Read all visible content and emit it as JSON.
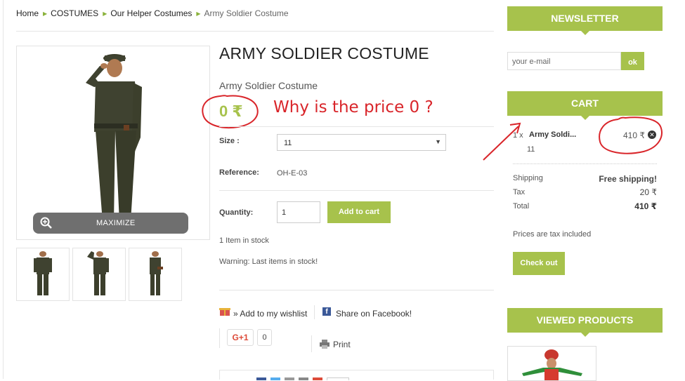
{
  "breadcrumb": {
    "items": [
      "Home",
      "COSTUMES",
      "Our Helper Costumes"
    ],
    "current": "Army Soldier Costume"
  },
  "product": {
    "title": "ARMY SOLDIER COSTUME",
    "subtitle": "Army Soldier Costume",
    "price": "0 ₹",
    "size_label": "Size :",
    "size_value": "11",
    "reference_label": "Reference:",
    "reference_value": "OH-E-03",
    "quantity_label": "Quantity:",
    "quantity_value": "1",
    "add_to_cart": "Add to cart",
    "stock": "1 Item in stock",
    "warning": "Warning: Last items in stock!",
    "maximize": "MAXIMIZE",
    "wishlist": "» Add to my wishlist",
    "facebook": "Share on Facebook!",
    "gplus": "G+1",
    "gplus_count": "0",
    "print": "Print"
  },
  "annotation": {
    "text": "Why is the price 0 ?",
    "color": "#d9252a"
  },
  "newsletter": {
    "title": "NEWSLETTER",
    "placeholder": "your e-mail",
    "ok": "ok"
  },
  "cart": {
    "title": "CART",
    "item": {
      "qty": "1 x",
      "name": "Army Soldi...",
      "price": "410 ₹",
      "attr": "11"
    },
    "shipping_label": "Shipping",
    "shipping_value": "Free shipping!",
    "tax_label": "Tax",
    "tax_value": "20 ₹",
    "total_label": "Total",
    "total_value": "410 ₹",
    "tax_note": "Prices are tax included",
    "checkout": "Check out"
  },
  "viewed": {
    "title": "VIEWED PRODUCTS"
  },
  "colors": {
    "accent": "#a7c24c",
    "annotation_red": "#d9252a"
  }
}
